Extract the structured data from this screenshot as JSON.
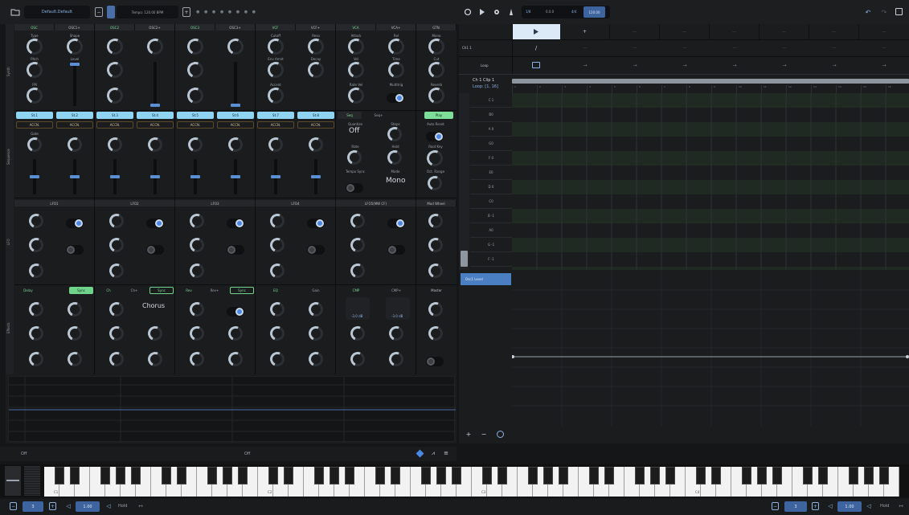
{
  "toolbar": {
    "preset": "Default.Default",
    "tempo": "Tempo: 120.00 BPM",
    "dots": "● ● ● ● ● ● ● ●"
  },
  "transport": {
    "label": "1/8",
    "position": "0.0.0",
    "signature": "4/4",
    "tempo": "120.00"
  },
  "sections": {
    "synth": "Synth",
    "sequence": "Sequence",
    "lfo": "LFO",
    "effects": "Effects"
  },
  "synth": {
    "headers": [
      "OSC",
      "OSC1+",
      "OSC2",
      "OSC2+",
      "OSC3",
      "OSC3+",
      "VCF",
      "VCF+",
      "VCA",
      "VCA+",
      "GTN"
    ],
    "labels": {
      "type": "Type",
      "pitch": "Pitch",
      "fm": "FM",
      "shape": "Shape",
      "level": "Level",
      "cutoff": "Cutoff",
      "env_amnt": "Env Amnt",
      "accent": "Accent",
      "reso": "Reso",
      "decay": "Decay",
      "attack": "Attack",
      "vel": "Vel",
      "rate_vel": "Rate Vel",
      "rel": "Rel",
      "time": "Time",
      "multitrig": "Multitrig",
      "mono": "Mono",
      "cut": "Cut",
      "reverb": "Reverb"
    }
  },
  "sequence": {
    "steps": [
      "St.1",
      "St.2",
      "St.3",
      "St.4",
      "St.5",
      "St.6",
      "St.7",
      "St.8"
    ],
    "accent": "ACCN.",
    "gate_label": "Gate",
    "tabs": [
      "Seq",
      "Seq+",
      "Play"
    ],
    "labels": {
      "quantize": "Quantize",
      "steps": "Steps",
      "auto_reset": "Auto Reset",
      "rate": "Rate",
      "hold": "Hold",
      "root_key": "Root Key",
      "tempo_sync": "Tempo Sync",
      "mode": "Mode",
      "oct_range": "Oct. Range"
    },
    "quantize": "Off",
    "mode": "Mono"
  },
  "lfo": {
    "headers": [
      "LFO1",
      "LFO2",
      "LFO3",
      "LFO4",
      "LFO5(MW CF)",
      "Mod Wheel"
    ]
  },
  "effects": {
    "headers": [
      "Delay",
      "Sync",
      "Ch",
      "Ch+",
      "Rev",
      "Rev+",
      "EQ",
      "Gain",
      "CMP",
      "CMP+",
      "Master"
    ],
    "chorus_preset": "Chorus",
    "cmp_db": "-3.0 dB",
    "cmp_plus_db": "-3.0 dB"
  },
  "clips": {
    "track": "Ch1 1",
    "loop": "Loop",
    "clip_title": "Ch 1 Clip 1",
    "loop_range": "Loop: [1, 16]"
  },
  "ruler": [
    "1",
    "2",
    "3",
    "4",
    "5",
    "6",
    "7",
    "8",
    "9",
    "10",
    "11",
    "12",
    "13",
    "14",
    "15",
    "16"
  ],
  "notes": [
    "C 1",
    "B0",
    "A 0",
    "G0",
    "F 0",
    "E0",
    "D 0",
    "C0",
    "B -1",
    "A0",
    "G -1",
    "F -1"
  ],
  "automation": {
    "param": "Osc1 Level"
  },
  "status": {
    "left": "Off",
    "center": "Off"
  },
  "keyboard": {
    "octave_labels": [
      "C1",
      "C2",
      "C3",
      "C4"
    ]
  },
  "bottom": {
    "octave": "3",
    "velocity": "1.00",
    "hold": "Hold",
    "octave_right": "3",
    "velocity_right": "1.00"
  }
}
